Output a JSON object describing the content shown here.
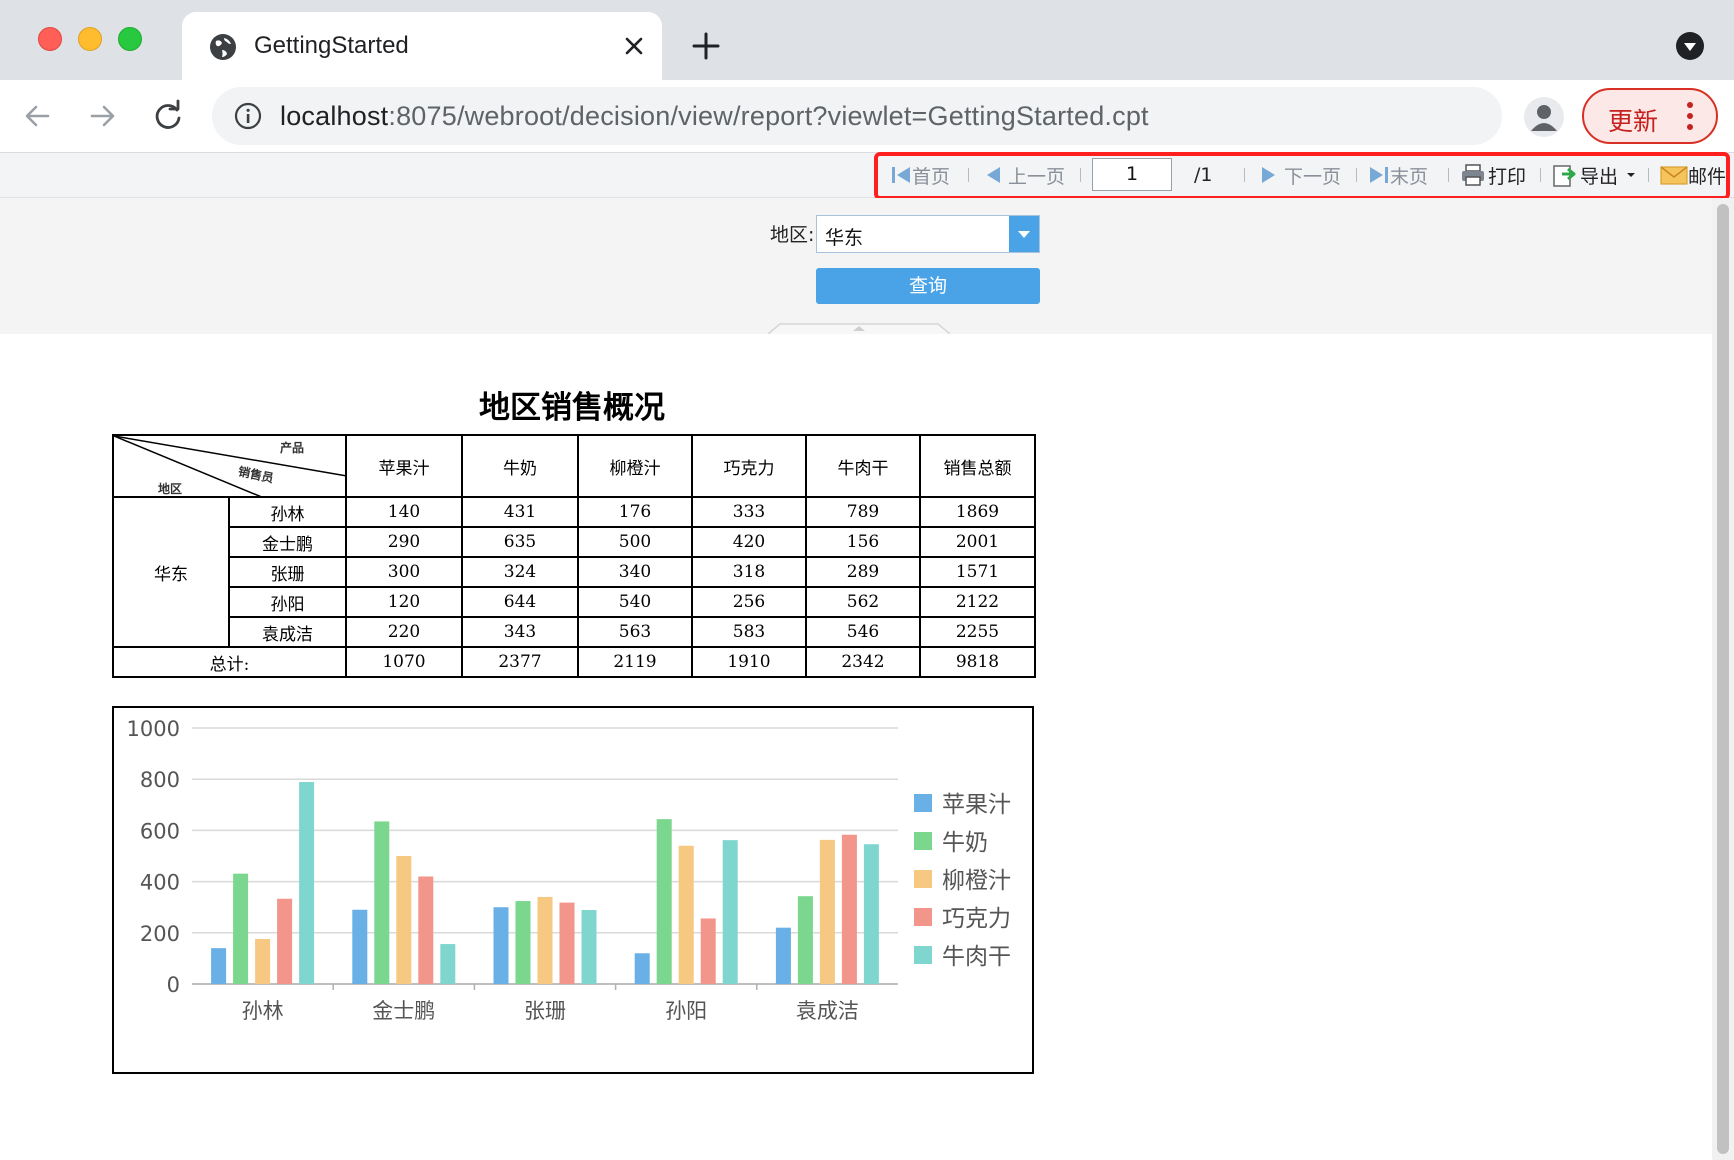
{
  "browser": {
    "tab_title": "GettingStarted",
    "url_host": "localhost",
    "url_rest": ":8075/webroot/decision/view/report?viewlet=GettingStarted.cpt",
    "update_label": "更新"
  },
  "report_toolbar": {
    "first": "首页",
    "prev": "上一页",
    "page_value": "1",
    "page_total": "/1",
    "next": "下一页",
    "last": "末页",
    "print": "打印",
    "export": "导出",
    "mail": "邮件"
  },
  "params": {
    "region_label": "地区:",
    "region_value": "华东",
    "query_label": "查询"
  },
  "report": {
    "title": "地区销售概况",
    "corner": {
      "product": "产品",
      "seller": "销售员",
      "region": "地区"
    },
    "columns": [
      "苹果汁",
      "牛奶",
      "柳橙汁",
      "巧克力",
      "牛肉干",
      "销售总额"
    ],
    "region": "华东",
    "rows": [
      {
        "name": "孙林",
        "values": [
          "140",
          "431",
          "176",
          "333",
          "789",
          "1869"
        ]
      },
      {
        "name": "金士鹏",
        "values": [
          "290",
          "635",
          "500",
          "420",
          "156",
          "2001"
        ]
      },
      {
        "name": "张珊",
        "values": [
          "300",
          "324",
          "340",
          "318",
          "289",
          "1571"
        ]
      },
      {
        "name": "孙阳",
        "values": [
          "120",
          "644",
          "540",
          "256",
          "562",
          "2122"
        ]
      },
      {
        "name": "袁成洁",
        "values": [
          "220",
          "343",
          "563",
          "583",
          "546",
          "2255"
        ]
      }
    ],
    "total_label": "总计:",
    "totals": [
      "1070",
      "2377",
      "2119",
      "1910",
      "2342",
      "9818"
    ]
  },
  "chart_data": {
    "type": "bar",
    "categories": [
      "孙林",
      "金士鹏",
      "张珊",
      "孙阳",
      "袁成洁"
    ],
    "series": [
      {
        "name": "苹果汁",
        "color": "#68b0e6",
        "values": [
          140,
          290,
          300,
          120,
          220
        ]
      },
      {
        "name": "牛奶",
        "color": "#7bd68e",
        "values": [
          431,
          635,
          324,
          644,
          343
        ]
      },
      {
        "name": "柳橙汁",
        "color": "#f6c882",
        "values": [
          176,
          500,
          340,
          540,
          563
        ]
      },
      {
        "name": "巧克力",
        "color": "#f2958a",
        "values": [
          333,
          420,
          318,
          256,
          583
        ]
      },
      {
        "name": "牛肉干",
        "color": "#7fd6cf",
        "values": [
          789,
          156,
          289,
          562,
          546
        ]
      }
    ],
    "yticks": [
      "0",
      "200",
      "400",
      "600",
      "800",
      "1000"
    ],
    "ylim": [
      0,
      1000
    ],
    "grid": true,
    "legend": "right"
  }
}
